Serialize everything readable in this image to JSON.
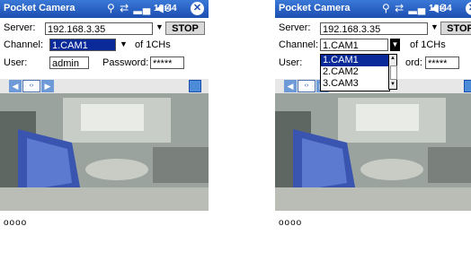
{
  "app": {
    "title": "Pocket Camera",
    "time": "10:44",
    "status_glyphs": "⚲ ⇄ ▂▄ ◀€"
  },
  "form": {
    "server_label": "Server:",
    "server_value": "192.168.3.35",
    "stop_label": "STOP",
    "channel_label": "Channel:",
    "channel_value": "1.CAM1",
    "channel_count": "of 1CHs",
    "user_label": "User:",
    "user_value": "admin",
    "password_label": "Password:",
    "password_label_partial": "ord:",
    "password_value": "*****"
  },
  "channel_options": [
    "1.CAM1",
    "2.CAM2",
    "3.CAM3"
  ],
  "nav": {
    "prev": "◀",
    "mid": "‹›",
    "next": "▶"
  },
  "footer": {
    "indicator": "oooo"
  }
}
